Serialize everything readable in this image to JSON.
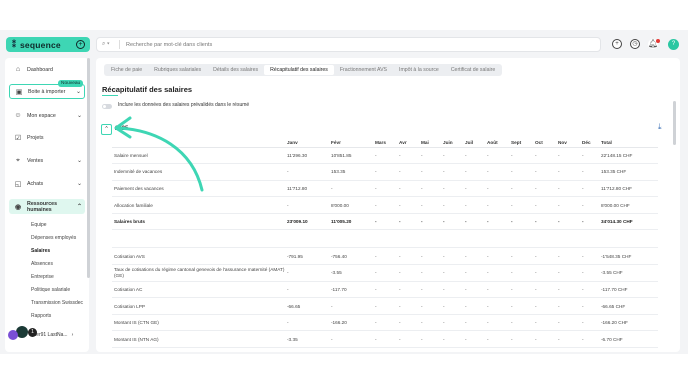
{
  "brand": {
    "name": "sequence",
    "mark": "⁑",
    "plus": "+"
  },
  "search": {
    "placeholder": "Recherche par mot-clé dans clients",
    "icon": "search-icon"
  },
  "topbar": {
    "icons": [
      "add-circle-icon",
      "clock-icon",
      "bell-icon"
    ],
    "avatar_initial": "?"
  },
  "sidebar": {
    "items": [
      {
        "label": "Dashboard",
        "icon": "home-icon"
      },
      {
        "label": "Boite à importer",
        "icon": "inbox-icon"
      },
      {
        "label": "Mon espace",
        "icon": "user-icon"
      },
      {
        "label": "Projets",
        "icon": "check-square-icon"
      },
      {
        "label": "Ventes",
        "icon": "tag-icon"
      },
      {
        "label": "Achats",
        "icon": "bag-icon"
      },
      {
        "label": "Ressources humaines",
        "icon": "people-icon"
      }
    ],
    "new_badge": "Nouveau",
    "subitems": [
      "Equipe",
      "Dépenses employés",
      "Salaires",
      "Absences",
      "Entreprise",
      "Politique salariale",
      "Transmission Swissdec",
      "Rapports"
    ],
    "user_label": "mer91 LastNa..."
  },
  "tabs": [
    "Fiche de paie",
    "Rubriques salariales",
    "Détails des salaires",
    "Récapitulatif des salaires",
    "Fractionnement AVS",
    "Impôt à la source",
    "Certificat de salaire"
  ],
  "active_tab": "Récapitulatif des salaires",
  "page_title": "Récapitulatif des salaires",
  "toggle_label": "Inclure les données des salaires prévalidés dans le résumé",
  "year": "2025",
  "year_toggle_glyph": "^",
  "table": {
    "headers": [
      "",
      "Janv",
      "Févr",
      "Mars",
      "Avr",
      "Mai",
      "Juin",
      "Juil",
      "Août",
      "Sept",
      "Oct",
      "Nov",
      "Déc",
      "Total"
    ],
    "rows": [
      [
        "Salaire mensuel",
        "11'296.30",
        "10'851.85",
        "-",
        "-",
        "-",
        "-",
        "-",
        "-",
        "-",
        "-",
        "-",
        "-",
        "22'148.15 CHF"
      ],
      [
        "Indemnité de vacances",
        "-",
        "153.35",
        "-",
        "-",
        "-",
        "-",
        "-",
        "-",
        "-",
        "-",
        "-",
        "-",
        "153.35 CHF"
      ],
      [
        "Paiement des vacances",
        "11'712.80",
        "-",
        "-",
        "-",
        "-",
        "-",
        "-",
        "-",
        "-",
        "-",
        "-",
        "-",
        "11'712.80 CHF"
      ],
      [
        "Allocation familiale",
        "-",
        "8'000.00",
        "-",
        "-",
        "-",
        "-",
        "-",
        "-",
        "-",
        "-",
        "-",
        "-",
        "8'000.00 CHF"
      ],
      [
        "Salaires bruts",
        "23'009.10",
        "11'005.20",
        "-",
        "-",
        "-",
        "-",
        "-",
        "-",
        "-",
        "-",
        "-",
        "-",
        "34'014.30 CHF"
      ],
      [
        "",
        "",
        "",
        "",
        "",
        "",
        "",
        "",
        "",
        "",
        "",
        "",
        "",
        ""
      ],
      [
        "Cotisation AVS",
        "-791.95",
        "-756.40",
        "-",
        "-",
        "-",
        "-",
        "-",
        "-",
        "-",
        "-",
        "-",
        "-",
        "-1'548.35 CHF"
      ],
      [
        "Taux de cotisations du régime cantonal genevois de l'assurance maternité (AMAT) (GE)",
        "-",
        "-3.55",
        "-",
        "-",
        "-",
        "-",
        "-",
        "-",
        "-",
        "-",
        "-",
        "-",
        "-3.55 CHF"
      ],
      [
        "Cotisation AC",
        "-",
        "-117.70",
        "-",
        "-",
        "-",
        "-",
        "-",
        "-",
        "-",
        "-",
        "-",
        "-",
        "-117.70 CHF"
      ],
      [
        "Cotisation LPP",
        "-66.65",
        "-",
        "-",
        "-",
        "-",
        "-",
        "-",
        "-",
        "-",
        "-",
        "-",
        "-",
        "-66.65 CHF"
      ],
      [
        "Montant IS (CTN GE)",
        "-",
        "-166.20",
        "-",
        "-",
        "-",
        "-",
        "-",
        "-",
        "-",
        "-",
        "-",
        "-",
        "-166.20 CHF"
      ],
      [
        "Montant IS (NTN AG)",
        "-3.35",
        "-",
        "-",
        "-",
        "-",
        "-",
        "-",
        "-",
        "-",
        "-",
        "-",
        "-",
        "-6.70 CHF"
      ]
    ]
  },
  "colors": {
    "accent": "#3ed6b4",
    "active_bg": "#dff7ef",
    "panel_bg": "#f3f4f6"
  }
}
